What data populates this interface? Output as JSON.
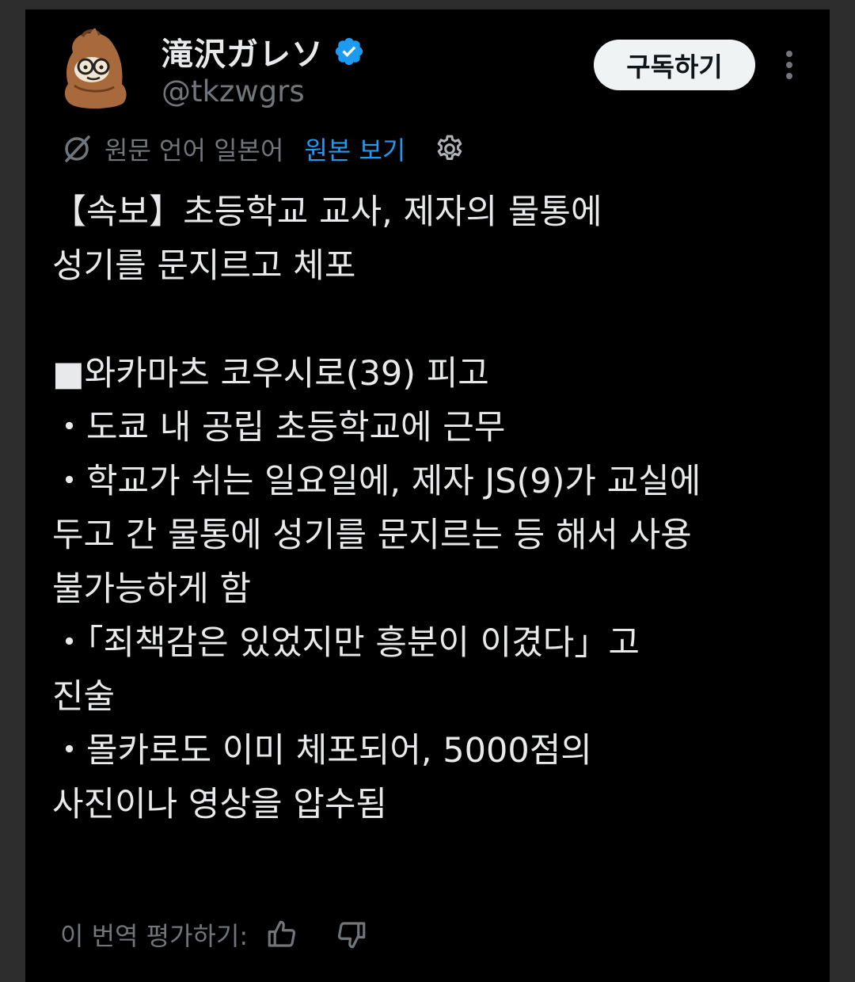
{
  "author": {
    "display_name": "滝沢ガレソ",
    "handle": "@tkzwgrs",
    "verified": true,
    "avatar_icon": "cartoon-creature-avatar"
  },
  "actions": {
    "subscribe_label": "구독하기",
    "more_icon": "more-vertical-icon"
  },
  "translation": {
    "source_label": "원문 언어 일본어",
    "show_original_label": "원본 보기",
    "settings_icon": "gear-icon",
    "translate_icon": "translate-slash-icon"
  },
  "tweet": {
    "text": "【속보】초등학교 교사, 제자의 물통에\n성기를 문지르고 체포\n\n■와카마츠 코우시로(39) 피고\n・도쿄 내 공립 초등학교에 근무\n・학교가 쉬는 일요일에, 제자 JS(9)가 교실에\n두고 간 물통에 성기를 문지르는 등 해서 사용\n불가능하게 함\n・「죄책감은 있었지만 흥분이 이겼다」고\n진술\n・몰카로도 이미 체포되어, 5000점의\n사진이나 영상을 압수됨"
  },
  "rating": {
    "label": "이 번역 평가하기:",
    "up_icon": "thumbs-up-icon",
    "down_icon": "thumbs-down-icon"
  },
  "colors": {
    "background": "#000000",
    "text": "#e7e9ea",
    "muted": "#71767b",
    "link": "#1d9bf0",
    "verified": "#1d9bf0"
  }
}
